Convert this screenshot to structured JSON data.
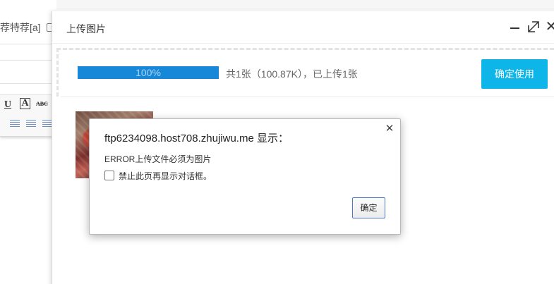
{
  "background_page": {
    "options_text": "荐特荐[a]",
    "toolbar": {
      "underline": "U",
      "font_color": "A",
      "strikethrough": "ABC"
    }
  },
  "upload_dialog": {
    "title": "上传图片",
    "progress": {
      "percent": 100,
      "label": "100%"
    },
    "status_text": "共1张（100.87K），已上传1张",
    "confirm_button": "确定使用",
    "colors": {
      "accent": "#0db5e8",
      "progress": "#1787d8"
    },
    "controls": [
      "minimize-icon",
      "maximize-icon",
      "close-icon"
    ]
  },
  "alert": {
    "title": "ftp6234098.host708.zhujiwu.me 显示：",
    "message": "ERROR上传文件必须为图片",
    "suppress_label": "禁止此页再显示对话框。",
    "ok_button": "确定"
  }
}
